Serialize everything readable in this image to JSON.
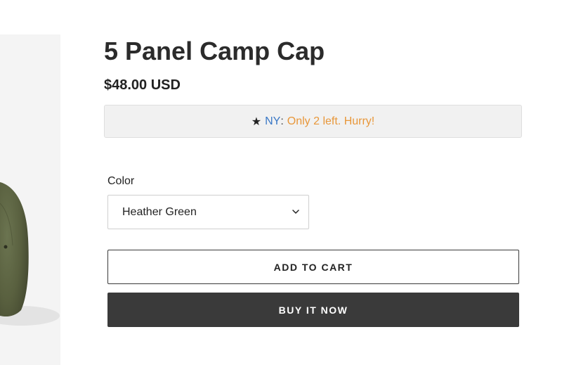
{
  "product": {
    "title": "5 Panel Camp Cap",
    "price": "$48.00 USD"
  },
  "stock": {
    "star": "★",
    "location": "NY",
    "separator": ":",
    "message": "Only 2 left. Hurry!"
  },
  "variant": {
    "label": "Color",
    "selected": "Heather Green"
  },
  "actions": {
    "add_to_cart": "ADD TO CART",
    "buy_now": "BUY IT NOW"
  },
  "colors": {
    "location": "#3a78c6",
    "urgency": "#e8973a",
    "buy_button": "#3a3a3a",
    "cap": "#5b6442"
  }
}
